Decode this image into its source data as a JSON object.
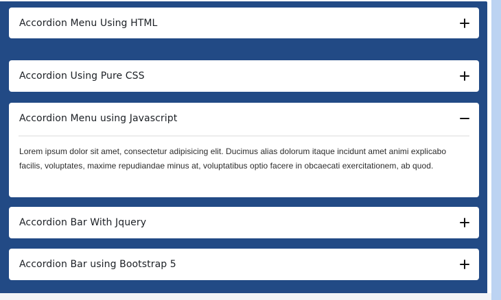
{
  "accordion": {
    "items": [
      {
        "title": "Accordion Menu Using HTML",
        "icon": "plus-icon",
        "expanded": false
      },
      {
        "title": "Accordion Using Pure CSS",
        "icon": "plus-icon",
        "expanded": false
      },
      {
        "title": "Accordion Menu using Javascript",
        "icon": "minus-icon",
        "expanded": true,
        "content": "Lorem ipsum dolor sit amet, consectetur adipisicing elit. Ducimus alias dolorum itaque incidunt amet animi explicabo facilis, voluptates, maxime repudiandae minus at, voluptatibus optio facere in obcaecati exercitationem, ab quod."
      },
      {
        "title": "Accordion Bar With Jquery",
        "icon": "plus-icon",
        "expanded": false
      },
      {
        "title": "Accordion Bar using Bootstrap 5",
        "icon": "plus-icon",
        "expanded": false
      }
    ]
  },
  "colors": {
    "panel_background": "#224a85",
    "item_background": "#ffffff",
    "side_strip": "#bcd3f2"
  }
}
